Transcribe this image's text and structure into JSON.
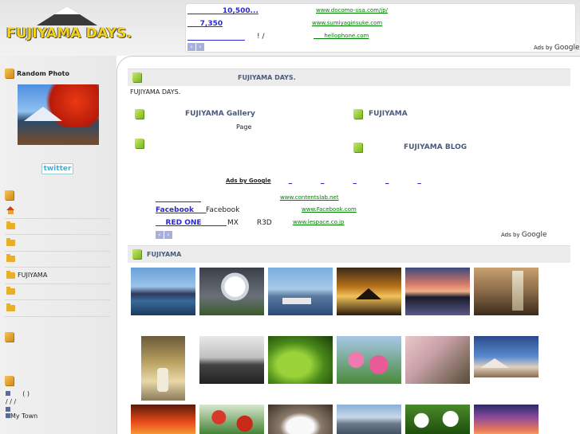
{
  "header": {
    "logo_text": "FUJIYAMA DAYS.",
    "top_ads": [
      {
        "title": "10,500...",
        "mid": "",
        "url": "www.docomo-usa.com/jp/"
      },
      {
        "title": "7,350",
        "mid": "",
        "url": "www.sumiyaginsuke.com"
      },
      {
        "title": "",
        "mid": "! / ",
        "url": "hellophone.com"
      }
    ],
    "nav_prev": "‹",
    "nav_next": "›",
    "ads_by": "Ads by",
    "google": "Google"
  },
  "sidebar": {
    "random_photo_heading": "Random Photo",
    "twitter_label": "twitter",
    "menu": [
      {
        "icon": "home-icon",
        "label": ""
      },
      {
        "icon": "folder-icon",
        "label": ""
      },
      {
        "icon": "folder-icon",
        "label": ""
      },
      {
        "icon": "folder-icon",
        "label": ""
      },
      {
        "icon": "folder-icon",
        "label": "FUJIYAMA"
      },
      {
        "icon": "folder-icon",
        "label": ""
      },
      {
        "icon": "folder-icon",
        "label": ""
      }
    ],
    "bottom_line_1": "( )",
    "bottom_line_2": "/ / /",
    "bottom_line_3": "My Town"
  },
  "main": {
    "site_heading": "FUJIYAMA DAYS.",
    "intro_text": "FUJIYAMA DAYS.",
    "gallery_link": "FUJIYAMA Gallery",
    "gallery_sub": "Page",
    "fujiyama_link": "FUJIYAMA",
    "blog_link": "FUJIYAMA BLOG",
    "mid_ads_label": "Ads by Google",
    "mid_ads": [
      {
        "title": "",
        "mid": "",
        "url": "www.contentslab.net"
      },
      {
        "title": "Facebook",
        "mid": "Facebook",
        "url": "www.Facebook.com"
      },
      {
        "title": "RED ONE",
        "mid": "MX        R3D",
        "url": "www.lespace.co.jp"
      }
    ],
    "ads_by": "Ads by",
    "google": "Google",
    "fujiyama_section": "FUJIYAMA"
  },
  "colors": {
    "link": "#2a2acc",
    "ad_url": "#008000",
    "heading": "#4a5a7a",
    "logo": "#f3d21a"
  }
}
